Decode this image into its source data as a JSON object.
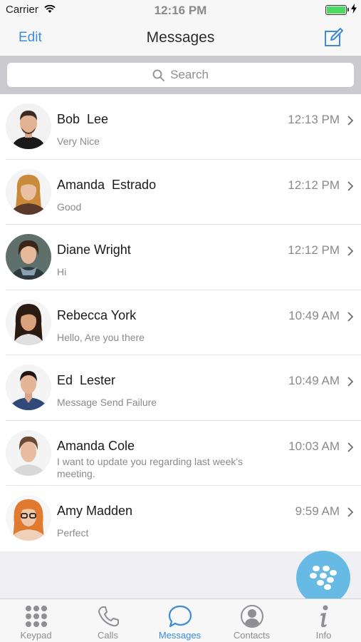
{
  "status": {
    "carrier": "Carrier",
    "time": "12:16 PM",
    "battery_level": 1.0
  },
  "nav": {
    "edit_label": "Edit",
    "title": "Messages"
  },
  "search": {
    "placeholder": "Search"
  },
  "conversations": [
    {
      "name": "Bob  Lee",
      "preview": "Very Nice",
      "time": "12:13 PM"
    },
    {
      "name": "Amanda  Estrado",
      "preview": "Good",
      "time": "12:12 PM"
    },
    {
      "name": "Diane Wright",
      "preview": "Hi",
      "time": "12:12 PM"
    },
    {
      "name": "Rebecca York",
      "preview": "Hello, Are you there",
      "time": "10:49 AM"
    },
    {
      "name": "Ed  Lester",
      "preview": "Message Send Failure",
      "time": "10:49 AM"
    },
    {
      "name": "Amanda Cole",
      "preview": "I want to update you regarding last week's meeting.",
      "time": "10:03 AM"
    },
    {
      "name": "Amy Madden",
      "preview": "Perfect",
      "time": "9:59 AM"
    }
  ],
  "tabs": [
    {
      "label": "Keypad",
      "icon": "keypad-icon"
    },
    {
      "label": "Calls",
      "icon": "phone-icon"
    },
    {
      "label": "Messages",
      "icon": "chat-bubble-icon",
      "active": true
    },
    {
      "label": "Contacts",
      "icon": "contact-icon"
    },
    {
      "label": "Info",
      "icon": "info-icon"
    }
  ],
  "colors": {
    "accent": "#3d8bd9",
    "fab": "#5cb6e3",
    "battery": "#4cd964"
  }
}
